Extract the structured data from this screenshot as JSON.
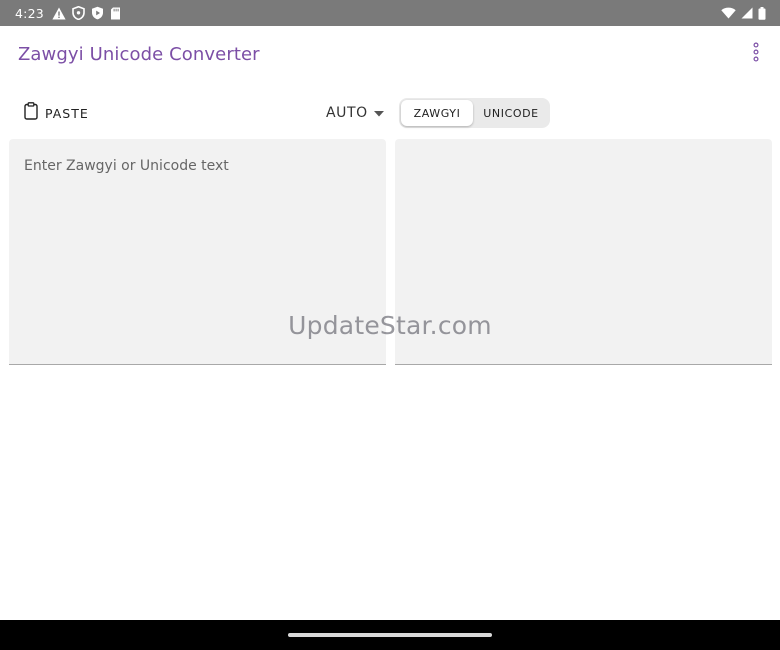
{
  "status_bar": {
    "time": "4:23",
    "left_icons": [
      "warning-icon",
      "vpn-shield-icon",
      "play-protect-icon",
      "sd-card-icon"
    ],
    "right_icons": [
      "wifi-icon",
      "signal-icon",
      "battery-icon"
    ]
  },
  "app_bar": {
    "title": "Zawgyi Unicode Converter",
    "menu_icon": "more-vert-icon",
    "accent_color": "#7c4fa6"
  },
  "toolbar": {
    "paste_label": "PASTE",
    "paste_icon": "clipboard-icon",
    "mode_select": {
      "selected": "AUTO",
      "icon": "arrow-drop-down-icon"
    },
    "encoding_toggle": {
      "options": [
        "ZAWGYI",
        "UNICODE"
      ],
      "selected": "ZAWGYI"
    }
  },
  "input_panel": {
    "placeholder": "Enter Zawgyi or Unicode text",
    "value": ""
  },
  "output_panel": {
    "value": ""
  },
  "watermark": "UpdateStar.com"
}
